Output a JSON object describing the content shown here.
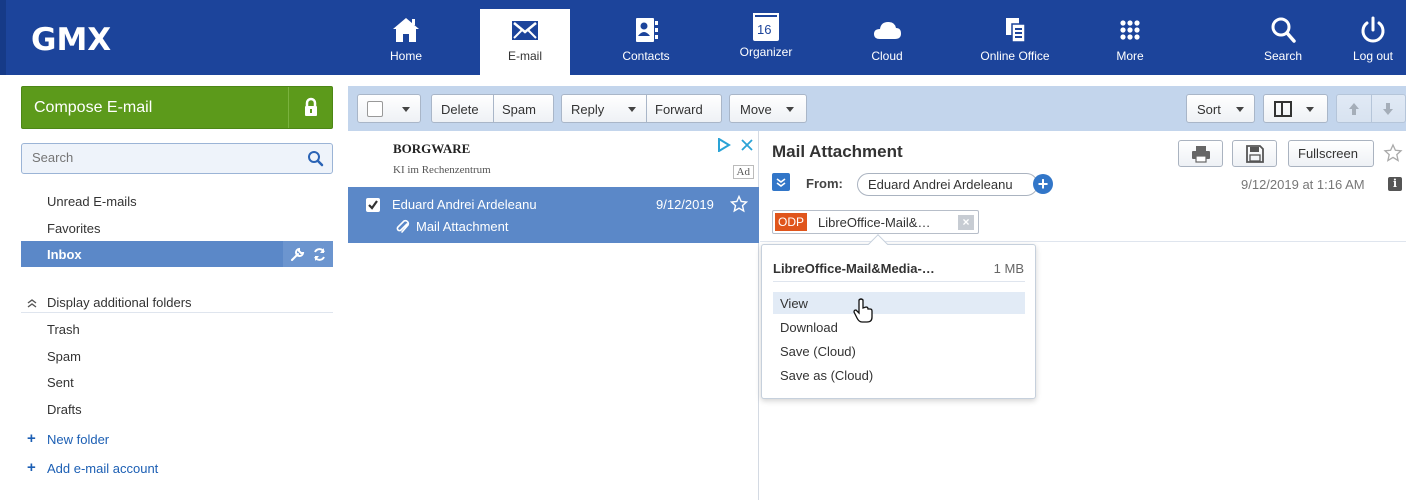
{
  "app": {
    "logo": "GMX"
  },
  "nav": {
    "home": "Home",
    "email": "E-mail",
    "contacts": "Contacts",
    "organizer": "Organizer",
    "organizer_day": "16",
    "cloud": "Cloud",
    "online_office": "Online Office",
    "more": "More",
    "search": "Search",
    "logout": "Log out"
  },
  "sidebar": {
    "compose": "Compose E-mail",
    "search_placeholder": "Search",
    "items": [
      {
        "label": "Unread E-mails"
      },
      {
        "label": "Favorites"
      },
      {
        "label": "Inbox"
      }
    ],
    "display_additional": "Display additional folders",
    "folders": [
      {
        "label": "Trash"
      },
      {
        "label": "Spam"
      },
      {
        "label": "Sent"
      },
      {
        "label": "Drafts"
      }
    ],
    "new_folder": "New folder",
    "add_account": "Add e-mail account"
  },
  "toolbar": {
    "delete": "Delete",
    "spam": "Spam",
    "reply": "Reply",
    "forward": "Forward",
    "move": "Move",
    "sort": "Sort"
  },
  "list": {
    "ad": {
      "brand": "BORGWARE",
      "sub": "KI im Rechenzentrum",
      "tag": "Ad"
    },
    "messages": [
      {
        "from": "Eduard Andrei Ardeleanu",
        "date": "9/12/2019",
        "subject": "Mail Attachment"
      }
    ]
  },
  "message": {
    "title": "Mail Attachment",
    "fullscreen": "Fullscreen",
    "from_label": "From:",
    "from_name": "Eduard Andrei Ardeleanu",
    "date": "9/12/2019 at 1:16 AM",
    "attachment": {
      "type": "ODP",
      "name": "LibreOffice-Mail&…"
    }
  },
  "popup": {
    "title": "LibreOffice-Mail&Media-…",
    "size": "1 MB",
    "items": [
      {
        "label": "View"
      },
      {
        "label": "Download"
      },
      {
        "label": "Save (Cloud)"
      },
      {
        "label": "Save as (Cloud)"
      }
    ]
  },
  "colors": {
    "brand_blue": "#1c449b",
    "compose_green": "#5c9a1b",
    "selection_blue": "#5b88c8",
    "toolbar_bg": "#c3d5ec",
    "odp_orange": "#e0551c"
  }
}
